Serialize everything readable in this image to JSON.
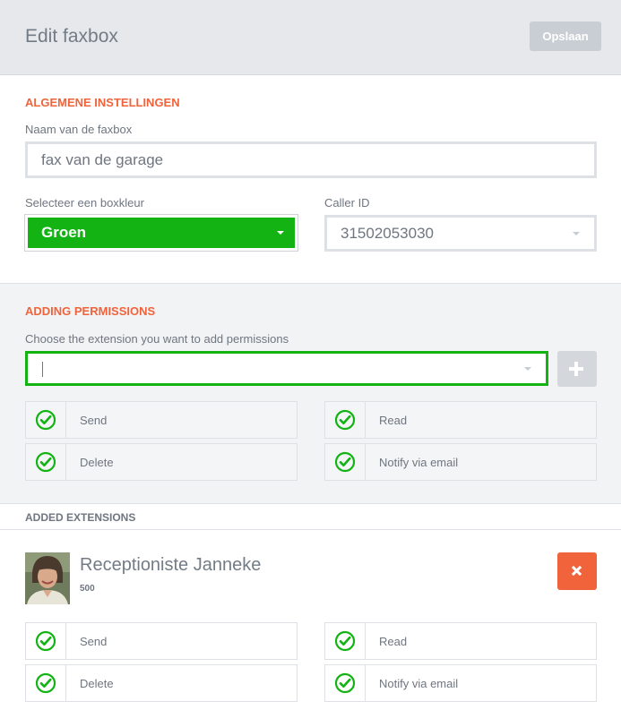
{
  "header": {
    "title": "Edit faxbox",
    "save_label": "Opslaan"
  },
  "general": {
    "section_title": "ALGEMENE INSTELLINGEN",
    "name_label": "Naam van de faxbox",
    "name_value": "fax van de garage",
    "color_label": "Selecteer een boxkleur",
    "color_value": "Groen",
    "color_hex": "#12b313",
    "callerid_label": "Caller ID",
    "callerid_value": "31502053030"
  },
  "permissions": {
    "section_title": "ADDING PERMISSIONS",
    "extension_label": "Choose the extension you want to add permissions",
    "extension_value": "",
    "items": [
      {
        "label": "Send",
        "checked": true
      },
      {
        "label": "Read",
        "checked": true
      },
      {
        "label": "Delete",
        "checked": true
      },
      {
        "label": "Notify via email",
        "checked": true
      }
    ]
  },
  "added": {
    "section_title": "ADDED EXTENSIONS",
    "extensions": [
      {
        "name": "Receptioniste Janneke",
        "number": "500",
        "permissions": [
          {
            "label": "Send",
            "checked": true
          },
          {
            "label": "Read",
            "checked": true
          },
          {
            "label": "Delete",
            "checked": true
          },
          {
            "label": "Notify via email",
            "checked": true
          }
        ]
      }
    ]
  },
  "colors": {
    "accent_orange": "#f0633b",
    "check_green": "#12b313"
  }
}
